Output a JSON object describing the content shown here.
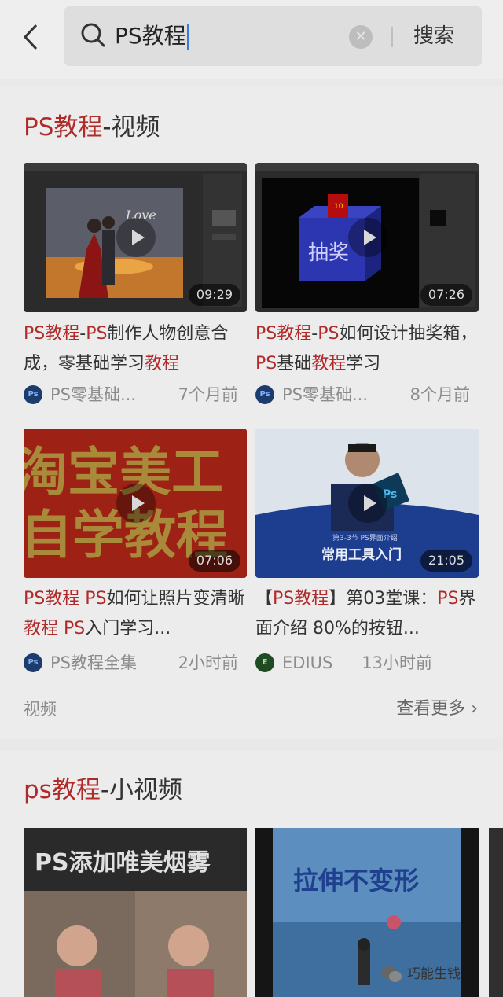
{
  "header": {
    "query": "PS教程",
    "search_button": "搜索"
  },
  "video_section": {
    "title_highlight": "PS教程",
    "title_rest": "-视频",
    "items": [
      {
        "title_parts": [
          [
            "PS教程",
            true
          ],
          [
            "-",
            false
          ],
          [
            "PS",
            true
          ],
          [
            "制作人物创意合成，零基础学习",
            false
          ],
          [
            "教程",
            true
          ]
        ],
        "duration": "09:29",
        "author": "PS零基础...",
        "time": "7个月前",
        "thumb_text": ""
      },
      {
        "title_parts": [
          [
            "PS教程",
            true
          ],
          [
            "-",
            false
          ],
          [
            "PS",
            true
          ],
          [
            "如何设计抽奖箱，",
            false
          ],
          [
            "PS",
            true
          ],
          [
            "基础",
            false
          ],
          [
            "教程",
            true
          ],
          [
            "学习",
            false
          ]
        ],
        "duration": "07:26",
        "author": "PS零基础...",
        "time": "8个月前",
        "thumb_text": "抽奖",
        "thumb_badge": "10"
      },
      {
        "title_parts": [
          [
            "PS教程",
            true
          ],
          [
            " ",
            false
          ],
          [
            "PS",
            true
          ],
          [
            "如何让照片变清晰",
            false
          ],
          [
            "教程",
            true
          ],
          [
            " ",
            false
          ],
          [
            "PS",
            true
          ],
          [
            "入门学习...",
            false
          ]
        ],
        "duration": "07:06",
        "author": "PS教程全集",
        "time": "2小时前",
        "thumb_line1": "淘宝美工",
        "thumb_line2": "自学教程"
      },
      {
        "title_parts": [
          [
            "【",
            false
          ],
          [
            "PS教程",
            true
          ],
          [
            "】第03堂课：",
            false
          ],
          [
            "PS",
            true
          ],
          [
            "界面介绍 80%的按钮...",
            false
          ]
        ],
        "duration": "21:05",
        "author": "EDIUS",
        "time": "13小时前",
        "thumb_sub": "第3-3节 PS界面介绍",
        "thumb_main": "常用工具入门",
        "thumb_badge": "Ps"
      }
    ],
    "footer_label": "视频",
    "more_label": "查看更多 ›"
  },
  "short_section": {
    "title_highlight": "ps教程",
    "title_rest": "-小视频",
    "items": [
      {
        "thumb_text": "PS添加唯美烟雾"
      },
      {
        "thumb_text": "拉伸不变形"
      }
    ]
  },
  "watermark": "巧能生钱",
  "colors": {
    "highlight": "#b02a2a",
    "background": "#e9e9e9"
  }
}
